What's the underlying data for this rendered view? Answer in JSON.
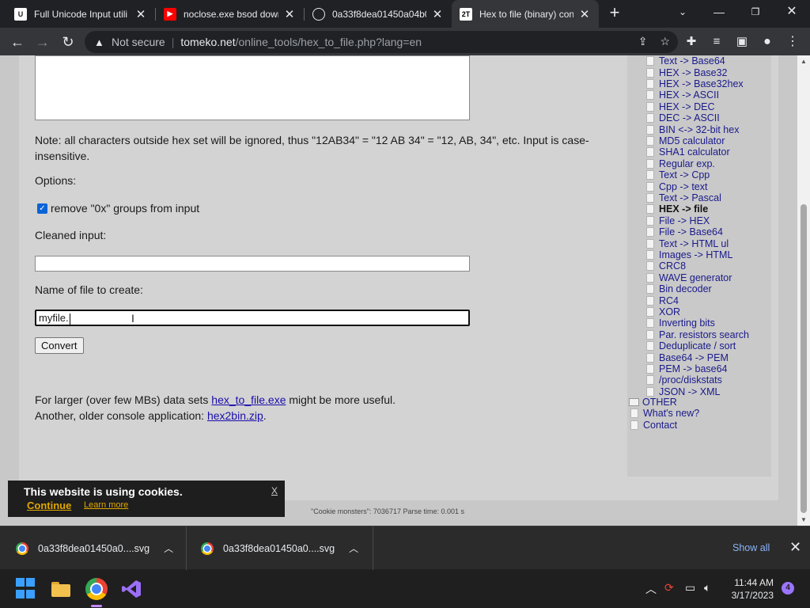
{
  "browser": {
    "tabs": [
      {
        "title": "Full Unicode Input utili",
        "icon": "u-favicon"
      },
      {
        "title": "noclose.exe bsod down",
        "icon": "youtube-favicon"
      },
      {
        "title": "0a33f8dea01450a04b0",
        "icon": "globe-favicon"
      },
      {
        "title": "Hex to file (binary) con",
        "icon": "tomeko-favicon"
      }
    ],
    "favicon_tomeko_text": "2T",
    "url_security": "Not secure",
    "url_host": "tomeko.net",
    "url_path": "/online_tools/hex_to_file.php?lang=en"
  },
  "page": {
    "note": "Note: all characters outside hex set will be ignored, thus \"12AB34\" = \"12 AB 34\" = \"12, AB, 34\", etc. Input is case-insensitive.",
    "options_label": "Options:",
    "remove_0x_label": "remove \"0x\" groups from input",
    "remove_0x_checked": true,
    "cleaned_label": "Cleaned input:",
    "cleaned_value": "",
    "filename_label": "Name of file to create:",
    "filename_value": "myfile.",
    "convert_label": "Convert",
    "larger_prefix": "For larger (over few MBs) data sets ",
    "larger_link": "hex_to_file.exe",
    "larger_suffix": " might be more useful.",
    "older_prefix": "Another, older console application: ",
    "older_link": "hex2bin.zip",
    "older_suffix": ".",
    "footer": "\"Cookie monsters\": 7036717     Parse time: 0.001 s"
  },
  "sidebar": {
    "items": [
      {
        "label": "Text -> Base64"
      },
      {
        "label": "HEX -> Base32"
      },
      {
        "label": "HEX -> Base32hex"
      },
      {
        "label": "HEX -> ASCII"
      },
      {
        "label": "HEX -> DEC"
      },
      {
        "label": "DEC -> ASCII"
      },
      {
        "label": "BIN <-> 32-bit hex"
      },
      {
        "label": "MD5 calculator"
      },
      {
        "label": "SHA1 calculator"
      },
      {
        "label": "Regular exp."
      },
      {
        "label": "Text -> Cpp"
      },
      {
        "label": "Cpp -> text"
      },
      {
        "label": "Text -> Pascal"
      },
      {
        "label": "HEX -> file"
      },
      {
        "label": "File -> HEX"
      },
      {
        "label": "File -> Base64"
      },
      {
        "label": "Text -> HTML ul"
      },
      {
        "label": "Images -> HTML"
      },
      {
        "label": "CRC8"
      },
      {
        "label": "WAVE generator"
      },
      {
        "label": "Bin decoder"
      },
      {
        "label": "RC4"
      },
      {
        "label": "XOR"
      },
      {
        "label": "Inverting bits"
      },
      {
        "label": "Par. resistors search"
      },
      {
        "label": "Deduplicate / sort"
      },
      {
        "label": "Base64 -> PEM"
      },
      {
        "label": "PEM -> base64"
      },
      {
        "label": "/proc/diskstats"
      },
      {
        "label": "JSON -> XML"
      }
    ],
    "current": "HEX -> file",
    "other": "OTHER",
    "whats_new": "What's new?",
    "contact": "Contact"
  },
  "cookie": {
    "title": "This website is using cookies.",
    "continue": "Continue",
    "learn_more": "Learn more",
    "close": "X"
  },
  "downloads": {
    "items": [
      {
        "name": "0a33f8dea01450a0....svg"
      },
      {
        "name": "0a33f8dea01450a0....svg"
      }
    ],
    "show_all": "Show all"
  },
  "taskbar": {
    "time": "11:44 AM",
    "date": "3/17/2023",
    "notifications": "4"
  }
}
